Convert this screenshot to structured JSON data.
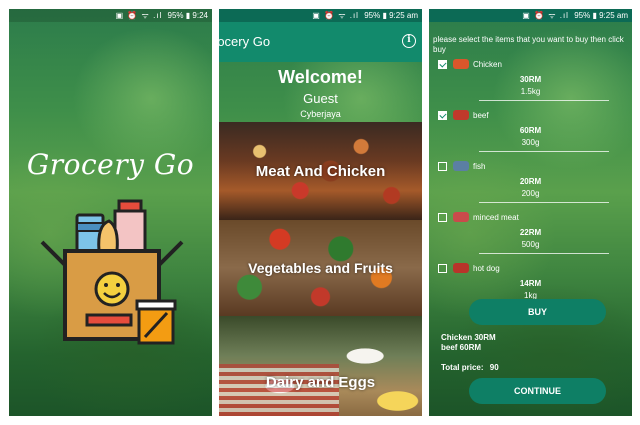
{
  "status_bar": {
    "left_screen": {
      "battery": "95%",
      "time": "9:24"
    },
    "middle_screen": {
      "battery": "95%",
      "time": "9:25 am"
    },
    "right_screen": {
      "battery": "95%",
      "time": "9:25 am"
    }
  },
  "splash": {
    "title": "Grocery Go",
    "logo_icon": "grocery-bag-icon"
  },
  "home": {
    "app_bar_title": "rocery Go",
    "info_label": "i",
    "welcome": "Welcome!",
    "user": "Guest",
    "location": "Cyberjaya",
    "categories": [
      {
        "label": "Meat And Chicken"
      },
      {
        "label": "Vegetables and Fruits"
      },
      {
        "label": "Dairy and Eggs"
      }
    ]
  },
  "items_screen": {
    "instruction": "please select the items that you want to buy then click\nbuy",
    "items": [
      {
        "name": "Chicken",
        "price": "30RM",
        "weight": "1.5kg",
        "checked": true,
        "icon": "chicken-icon",
        "icon_color": "#d9562b"
      },
      {
        "name": "beef",
        "price": "60RM",
        "weight": "300g",
        "checked": true,
        "icon": "beef-icon",
        "icon_color": "#c0392b"
      },
      {
        "name": "fish",
        "price": "20RM",
        "weight": "200g",
        "checked": false,
        "icon": "fish-icon",
        "icon_color": "#5b7fa3"
      },
      {
        "name": "minced meat",
        "price": "22RM",
        "weight": "500g",
        "checked": false,
        "icon": "minced-meat-icon",
        "icon_color": "#c94b4b"
      },
      {
        "name": "hot dog",
        "price": "14RM",
        "weight": "1kg",
        "checked": false,
        "icon": "hot-dog-icon",
        "icon_color": "#b8342a"
      }
    ],
    "buy_label": "BUY",
    "summary_lines": [
      "Chicken 30RM",
      "beef 60RM"
    ],
    "total_label": "Total price:",
    "total_value": "90",
    "continue_label": "CONTINUE"
  },
  "colors": {
    "primary": "#128a6c",
    "button": "#0e7f65"
  }
}
